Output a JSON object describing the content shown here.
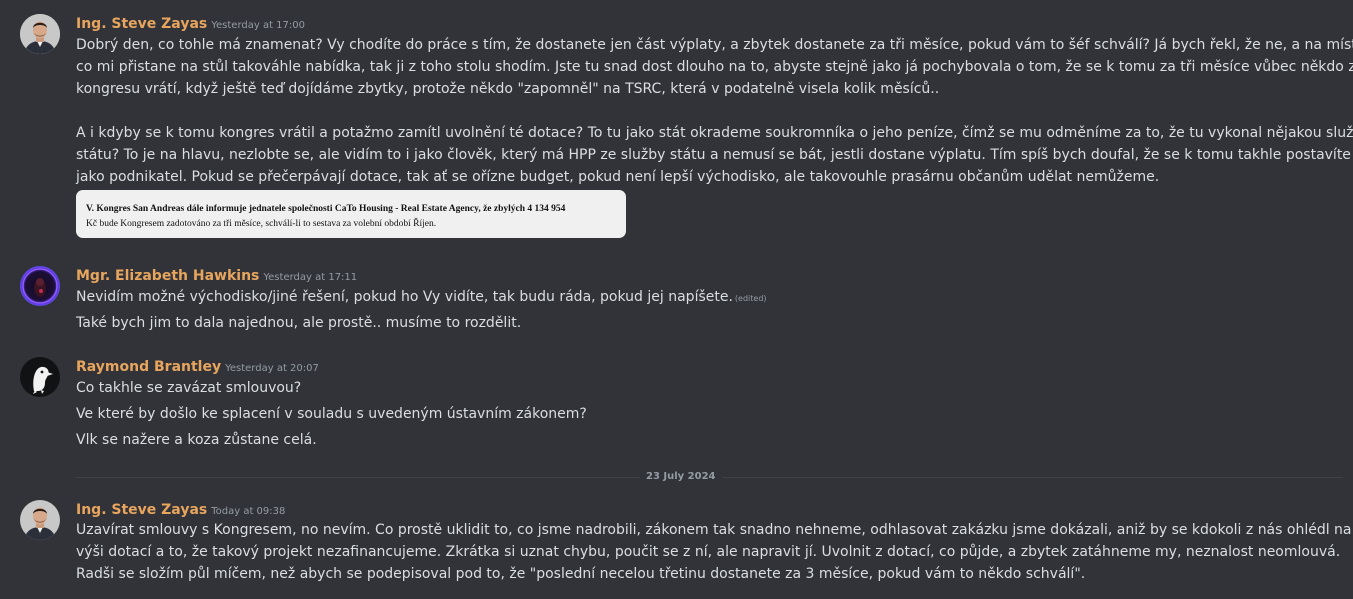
{
  "colors": {
    "background": "#313338",
    "author_name": "#e7a55e",
    "message_text": "#dbdee1",
    "timestamp": "#949ba4"
  },
  "messages": [
    {
      "author": "Ing. Steve Zayas",
      "timestamp": "Yesterday at 17:00",
      "avatar": "person-avatar-icon",
      "lines": [
        "Dobrý den, co tohle má znamenat? Vy chodíte do práce s tím, že dostanete jen část výplaty, a zbytek dostanete za tři měsíce, pokud vám to šéf schválí? Já bych řekl, že ne, a na místě,",
        "co mi přistane na stůl takováhle nabídka, tak ji z toho stolu shodím. Jste tu snad dost dlouho na to, abyste stejně jako já pochybovala o tom, že se k tomu za tři měsíce vůbec někdo z",
        "kongresu vrátí, když ještě teď dojídáme zbytky, protože někdo \"zapomněl\" na TSRC, která v podatelně visela kolik měsíců..",
        "A i kdyby se k tomu kongres vrátil a potažmo zamítl uvolnění té dotace? To tu jako stát okrademe soukromníka o jeho peníze, čímž se mu odměníme za to, že tu vykonal nějakou službu",
        "státu? To je na hlavu, nezlobte se, ale vidím to i jako člověk, který má HPP ze služby státu a nemusí se bát, jestli dostane výplatu. Tím spíš bych doufal, že se k tomu takhle postavíte",
        "jako podnikatel. Pokud se přečerpávají dotace, tak ať se ořízne budget, pokud není lepší východisko, ale takovouhle prasárnu občanům udělat nemůžeme."
      ],
      "image_lines": [
        "V. Kongres San Andreas dále informuje jednatele společnosti CaTo Housing - Real Estate Agency, že zbylých 4 134 954",
        "Kč bude Kongresem zadotováno za tři měsíce, schválí-li to sestava za volební období Říjen."
      ]
    },
    {
      "author": "Mgr. Elizabeth Hawkins",
      "timestamp": "Yesterday at 17:11",
      "avatar": "neon-avatar-icon",
      "lines": [
        "Nevidím možné východisko/jiné řešení, pokud ho Vy vidíte, tak budu ráda, pokud jej napíšete.",
        "Také bych jim to dala najednou, ale prostě.. musíme to rozdělit."
      ],
      "edited_label": "(edited)"
    },
    {
      "author": "Raymond Brantley",
      "timestamp": "Yesterday at 20:07",
      "avatar": "penguin-avatar-icon",
      "lines": [
        "Co takhle se zavázat smlouvou?",
        "Ve které by došlo ke splacení v souladu s uvedeným ústavním zákonem?",
        "Vlk se nažere a koza zůstane celá."
      ]
    },
    {
      "author": "Ing. Steve Zayas",
      "timestamp": "Today at 09:38",
      "avatar": "person-avatar-icon",
      "lines": [
        "Uzavírat smlouvy s Kongresem, no nevím. Co prostě uklidit to, co jsme nadrobili, zákonem tak snadno nehneme, odhlasovat zakázku jsme dokázali, aniž by se kdokoli z nás ohlédl na",
        "výši dotací a to, že takový projekt nezafinancujeme. Zkrátka si uznat chybu, poučit se z ní, ale napravit jí. Uvolnit z dotací, co půjde, a zbytek zatáhneme my, neznalost neomlouvá.",
        "Radši se složím půl míčem, než abych se podepisoval pod to, že \"poslední necelou třetinu dostanete za 3 měsíce, pokud vám to někdo schválí\"."
      ]
    }
  ],
  "date_divider": "23 July 2024"
}
